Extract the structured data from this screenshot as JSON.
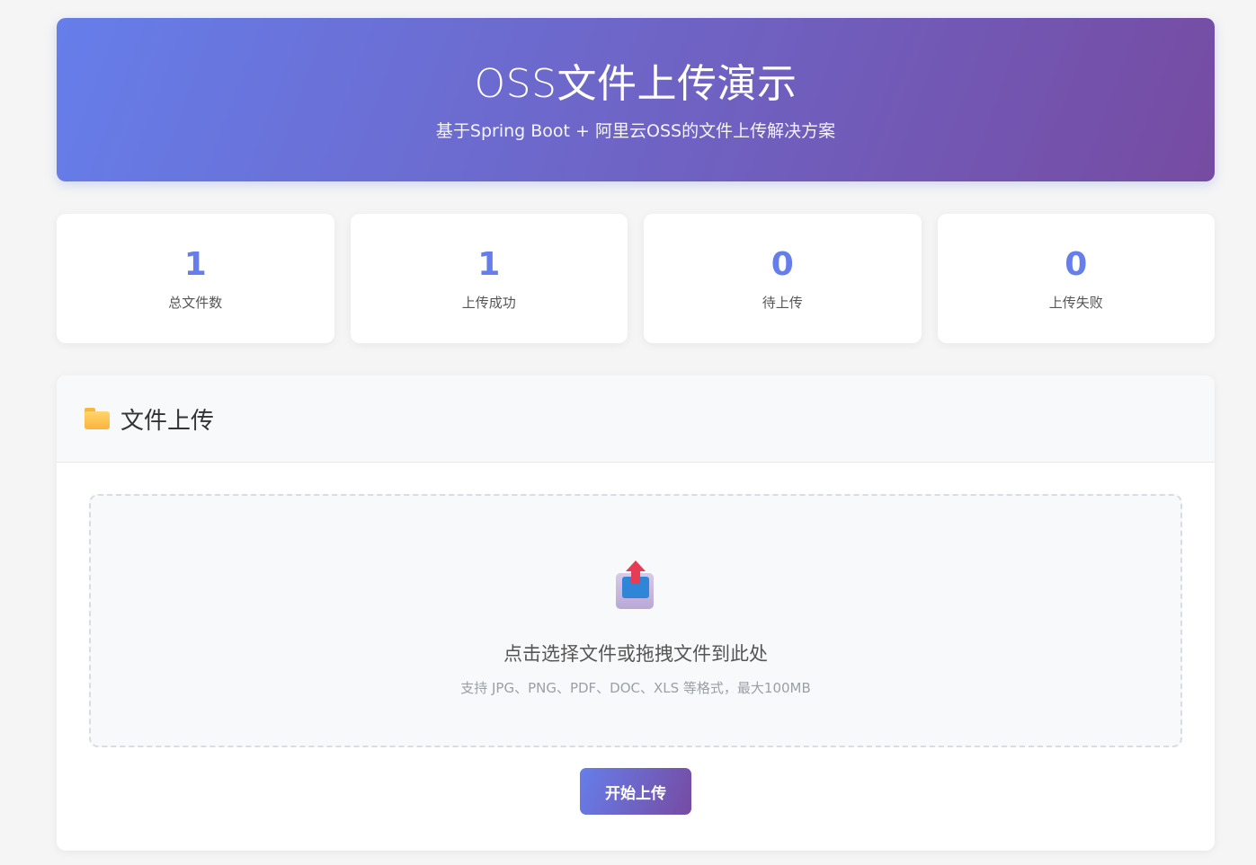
{
  "header": {
    "title": "OSS文件上传演示",
    "subtitle": "基于Spring Boot + 阿里云OSS的文件上传解决方案"
  },
  "stats": [
    {
      "value": "1",
      "label": "总文件数"
    },
    {
      "value": "1",
      "label": "上传成功"
    },
    {
      "value": "0",
      "label": "待上传"
    },
    {
      "value": "0",
      "label": "上传失败"
    }
  ],
  "upload": {
    "section_title": "文件上传",
    "section_icon": "folder-icon",
    "drop_icon": "upload-icon",
    "drop_text": "点击选择文件或拖拽文件到此处",
    "drop_hint": "支持 JPG、PNG、PDF、DOC、XLS 等格式，最大100MB",
    "start_button": "开始上传"
  },
  "colors": {
    "accent_start": "#667eea",
    "accent_end": "#764ba2"
  }
}
